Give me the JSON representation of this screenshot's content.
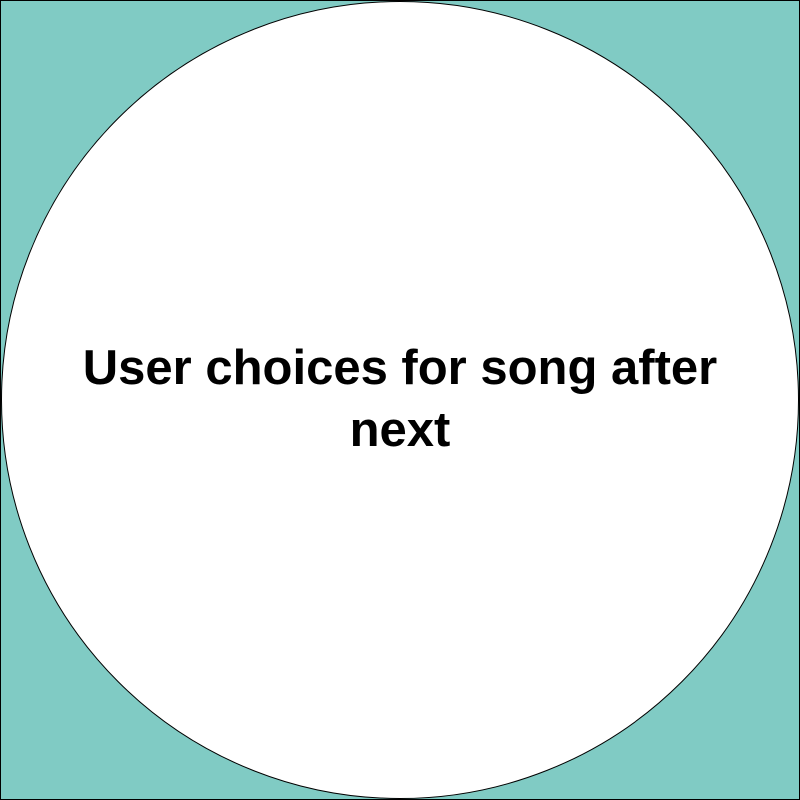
{
  "node": {
    "label": "User choices for song after next"
  },
  "colors": {
    "background": "#80cbc4",
    "node_fill": "#ffffff",
    "node_stroke": "#000000",
    "text": "#000000"
  }
}
